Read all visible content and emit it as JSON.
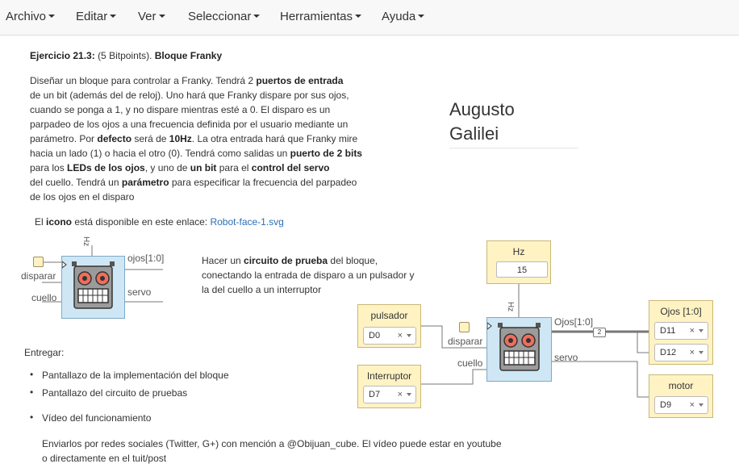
{
  "menu": {
    "items": [
      "Archivo",
      "Editar",
      "Ver",
      "Seleccionar",
      "Herramientas",
      "Ayuda"
    ]
  },
  "exercise": {
    "label": "Ejercicio 21.3:",
    "points": "(5 Bitpoints).",
    "name": "Bloque Franky"
  },
  "description": {
    "l1a": "Diseñar un bloque para controlar a Franky. Tendrá 2 ",
    "l1b": "puertos de entrada",
    "l2": "de un bit (además del de reloj). Uno hará que Franky dispare por sus ojos,",
    "l3": "cuando se ponga a 1, y no dispare mientras esté a 0. El disparo es un",
    "l4": "parpadeo de los ojos a una frecuencia definida por el usuario mediante un",
    "l5a": "parámetro. Por ",
    "l5b": "defecto",
    "l5c": " será de ",
    "l5d": "10Hz",
    "l5e": ". La otra entrada hará que Franky mire",
    "l6a": "hacia un lado (1) o hacia el otro (0). Tendrá como salidas un ",
    "l6b": "puerto de 2 bits",
    "l7a": "para los ",
    "l7b": "LEDs de los ojos",
    "l7c": ", y uno de ",
    "l7d": "un bit",
    "l7e": " para el ",
    "l7f": "control del servo",
    "l8a": "del cuello. Tendrá un ",
    "l8b": "parámetro",
    "l8c": " para especificar la frecuencia del parpadeo",
    "l9": "de los ojos en el disparo"
  },
  "icon_line": {
    "a": "El ",
    "b": "icono",
    "c": " está disponible en este enlace: ",
    "link": "Robot-face-1.svg"
  },
  "author": {
    "line1": "Augusto",
    "line2": "Galilei"
  },
  "block": {
    "param": "Hz",
    "out_bus": "ojos[1:0]",
    "out_servo": "servo",
    "in_fire": "disparar",
    "in_neck": "cuello"
  },
  "test_desc": {
    "a": "Hacer un ",
    "b": "circuito de prueba",
    "c": " del bloque,",
    "l2": "conectando la entrada de disparo a un pulsador y",
    "l3": "la del cuello a un interruptor"
  },
  "circuit": {
    "hz_title": "Hz",
    "hz_value": "15",
    "pulsador_title": "pulsador",
    "pulsador_pin": "D0",
    "interruptor_title": "Interruptor",
    "interruptor_pin": "D7",
    "block_in_fire": "disparar",
    "block_in_neck": "cuello",
    "block_param": "Hz",
    "block_out_bus": "Ojos[1:0]",
    "block_out_servo": "servo",
    "bus_width": "2",
    "ojos_title": "Ojos [1:0]",
    "ojos_pin1": "D11",
    "ojos_pin2": "D12",
    "motor_title": "motor",
    "motor_pin": "D9",
    "remove_glyph": "×"
  },
  "deliver": {
    "title": "Entregar:",
    "items": [
      "Pantallazo de la implementación del bloque",
      "Pantallazo del circuito de pruebas",
      "Vídeo del funcionamiento"
    ],
    "send_l1": "Enviarlos por redes sociales (Twitter, G+) con mención a @Obijuan_cube. El vídeo puede estar en youtube",
    "send_l2": "o directamente en el tuit/post"
  },
  "colors": {
    "block_fill": "#cfe6f4",
    "io_fill": "#fff3c4",
    "link": "#2a6fb5"
  }
}
